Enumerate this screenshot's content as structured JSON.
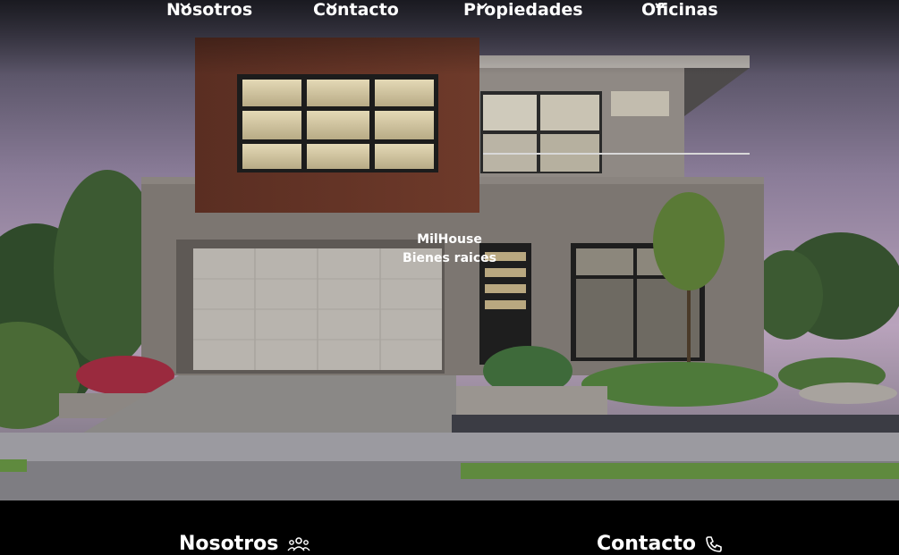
{
  "nav": {
    "items": [
      {
        "label": "Nosotros"
      },
      {
        "label": "Contacto"
      },
      {
        "label": "Propiedades"
      },
      {
        "label": "Oficinas"
      }
    ]
  },
  "brand": {
    "name": "MilHouse",
    "tagline": "Bienes raices"
  },
  "footer": {
    "nosotros_label": "Nosotros",
    "nosotros_icon": "people-icon",
    "contacto_label": "Contacto",
    "contacto_icon": "phone-icon"
  }
}
